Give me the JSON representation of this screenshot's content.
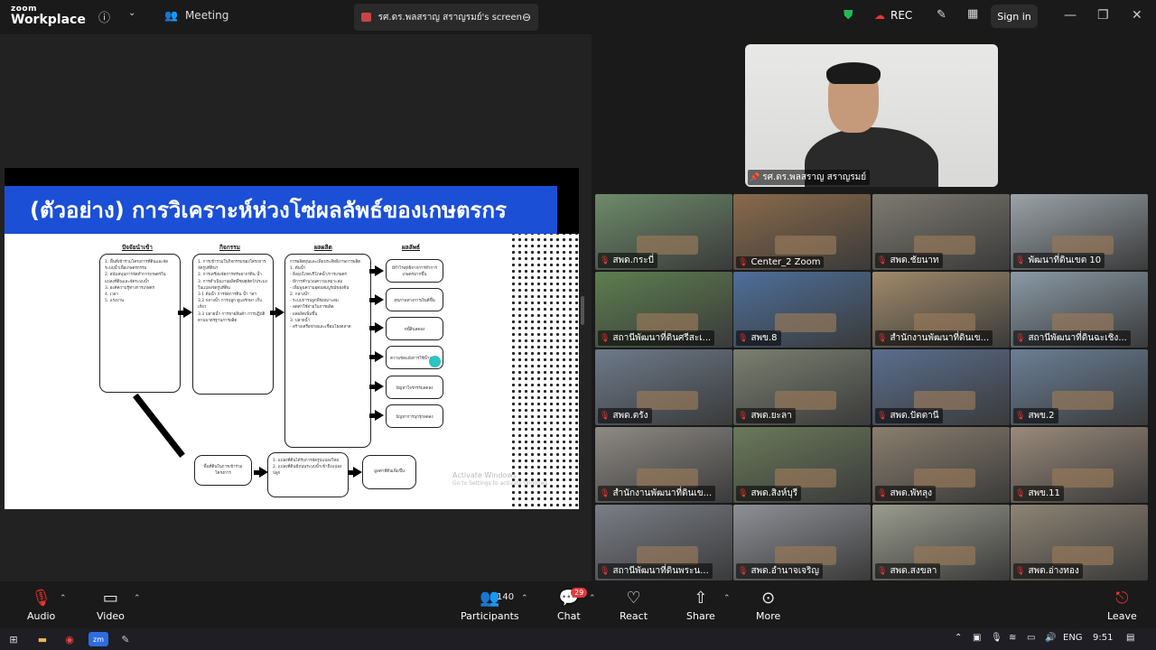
{
  "topbar": {
    "logo_line1": "zoom",
    "logo_line2": "Workplace",
    "info_icon": "info-icon",
    "meeting_label": "Meeting",
    "share_title": "รศ.ดร.พลสราญ สราญรมย์'s screen",
    "rec_label": "REC",
    "signin_label": "Sign in"
  },
  "slide": {
    "title": "(ตัวอย่าง) การวิเคราะห์ห่วงโซ่ผลลัพธ์ของเกษตรกร",
    "headers": [
      "ปัจจัยนำเข้า",
      "กิจกรรม",
      "ผลผลิต",
      "ผลลัพธ์"
    ],
    "inputs_text": "1. พื้นที่เข้าร่วมโครงการที่ดินและจัดระบบน้ำเพื่อเกษตรกรรม\n2. สนับสนุนการจัดทำการเกษตรในแปลงที่ดินและจัดระบบน้ำ\n3. องค์ความรู้ทางการเกษตร\n4. เวลา\n5. แรงงาน",
    "activities_text": "1. การเข้าร่วมในกิจกรรมของโครงการจัดรูปที่ดินฯ\n2. การเตรียมจัดการทรัพยากรดิน น้ำ\n3. การดำเนินงานผลิตพืชปศุสัตว์/ประมงในแปลงจัดรูปที่ดิน\n 3.1 ต้นน้ำ การจัดการดิน น้ำ ฯลฯ\n 3.2 กลางน้ำ การปลูก ดูแลรักษา เก็บเกี่ยว\n 3.3 ปลายน้ำ การขายสินค้า การปฏิบัติตามมาตรฐานการผลิต",
    "outputs_text": "การผลิตทุนและเพิ่มประสิทธิภาพการผลิต\n1. ต้นน้ำ\n - สิ่งอุปโภคบริโภคน้ำ/การเกษตร\n - มีการคำนวณความเหมาะสม\n - เพิ่มพูนความอุดมสมบูรณ์ของดิน\n2. กลางน้ำ\n - ระบบการปลูกพืชเหมาะสม\n - ลดค่าใช้จ่ายในการผลิต\n - ผลผลิตเพิ่มขึ้น\n3. ปลายน้ำ\n - สร้างเครือข่ายและเชื่อมโยงตลาด",
    "result_boxes": [
      "มีกำไรสุทธิจากการทำการเกษตรมากขึ้น",
      "สุขภาพทางการเงินดีขึ้น",
      "หนี้สินลดลง",
      "ความขัดแย้งการใช้น้ำลดลง",
      "ปัญหาโจรกรรมลดลง",
      "ปัญหาการบุกรุกลดลง"
    ],
    "bottom_left": "พื้นที่ดินในการเข้าร่วมโครงการ",
    "bottom_mid": "1. แปลงที่ดินได้รับการจัดรูปแปลงใหม่\n2. แปลงที่ดินมีถนนระบบน้ำเข้าถึงแปลงปลูก",
    "bottom_right": "มูลค่าที่ดินเพิ่มขึ้น",
    "watermark": "Activate Windows",
    "watermark_sub": "Go to Settings to activate Windows."
  },
  "speaker": {
    "name": "รศ.ดร.พลสราญ สราญรมย์"
  },
  "tiles": [
    {
      "name": "สพด.กระบี่",
      "bg": "#6d8b6a"
    },
    {
      "name": "Center_2 Zoom",
      "bg": "#8a6a4a"
    },
    {
      "name": "สพด.ชัยนาท",
      "bg": "#7d7a70"
    },
    {
      "name": "พัฒนาที่ดินเขต 10",
      "bg": "#9aa3a8"
    },
    {
      "name": "สถานีพัฒนาที่ดินศรีสะเ...",
      "bg": "#5d7e4f"
    },
    {
      "name": "สพข.8",
      "bg": "#4d6f9a"
    },
    {
      "name": "สำนักงานพัฒนาที่ดินเข...",
      "bg": "#a08a6a"
    },
    {
      "name": "สถานีพัฒนาที่ดินฉะเชิง...",
      "bg": "#8a9aa6"
    },
    {
      "name": "สพด.ตรัง",
      "bg": "#6d7a8a"
    },
    {
      "name": "สพด.ยะลา",
      "bg": "#7a8070"
    },
    {
      "name": "สพด.ปัตตานี",
      "bg": "#5a6e8e"
    },
    {
      "name": "สพข.2",
      "bg": "#6a7f96"
    },
    {
      "name": "สำนักงานพัฒนาที่ดินเข...",
      "bg": "#8e8a84"
    },
    {
      "name": "สพด.สิงห์บุรี",
      "bg": "#6a7a5a"
    },
    {
      "name": "สพด.พัทลุง",
      "bg": "#8a7e6e"
    },
    {
      "name": "สพข.11",
      "bg": "#9a8a7a"
    },
    {
      "name": "สถานีพัฒนาที่ดินพระน...",
      "bg": "#7a7e86"
    },
    {
      "name": "สพด.อำนาจเจริญ",
      "bg": "#8e9096"
    },
    {
      "name": "สพด.สงขลา",
      "bg": "#9a9c8e"
    },
    {
      "name": "สพด.อ่างทอง",
      "bg": "#8e8474"
    }
  ],
  "bottom": {
    "audio": "Audio",
    "video": "Video",
    "participants": "Participants",
    "participants_count": "140",
    "chat": "Chat",
    "chat_badge": "29",
    "react": "React",
    "share": "Share",
    "more": "More",
    "leave": "Leave"
  },
  "taskbar": {
    "lang": "ENG",
    "time": "9:51"
  }
}
